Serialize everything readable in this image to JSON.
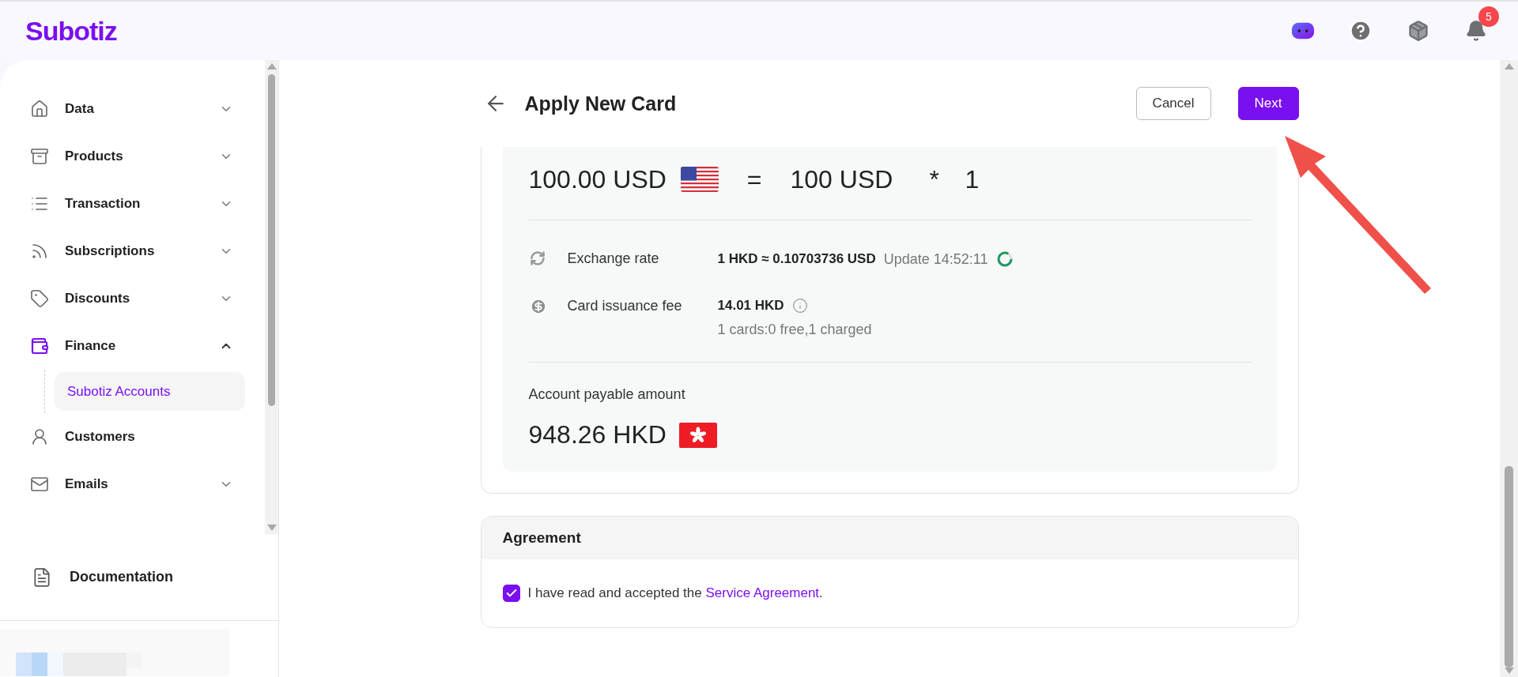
{
  "header": {
    "logo": "Subotiz",
    "notification_count": "5"
  },
  "sidebar": {
    "items": [
      {
        "label": "Data",
        "kind": "group",
        "expanded": false,
        "active": false
      },
      {
        "label": "Products",
        "kind": "group",
        "expanded": false,
        "active": false
      },
      {
        "label": "Transaction",
        "kind": "group",
        "expanded": false,
        "active": false
      },
      {
        "label": "Subscriptions",
        "kind": "group",
        "expanded": false,
        "active": false
      },
      {
        "label": "Discounts",
        "kind": "group",
        "expanded": false,
        "active": false
      },
      {
        "label": "Finance",
        "kind": "group",
        "expanded": true,
        "active": true,
        "children": [
          {
            "label": "Subotiz Accounts",
            "selected": true
          }
        ]
      },
      {
        "label": "Customers",
        "kind": "link",
        "active": false
      },
      {
        "label": "Emails",
        "kind": "group",
        "expanded": false,
        "active": false
      }
    ],
    "footer": {
      "label": "Documentation"
    }
  },
  "page": {
    "title": "Apply New Card",
    "buttons": [
      {
        "label": "Cancel",
        "kind": "secondary"
      },
      {
        "label": "Next",
        "kind": "primary"
      }
    ]
  },
  "summary": {
    "total": "100.00 USD",
    "equals": "=",
    "per_card": "100 USD",
    "times": "*",
    "count": "1"
  },
  "details": [
    {
      "kind": "rate",
      "label": "Exchange rate",
      "value": "1 HKD ≈ 0.10703736 USD",
      "note": "Update 14:52:11"
    },
    {
      "kind": "fee",
      "label": "Card issuance fee",
      "value": "14.01 HKD",
      "note": "1 cards:0 free,1 charged"
    }
  ],
  "payable": {
    "label": "Account payable amount",
    "amount": "948.26 HKD"
  },
  "agreement": {
    "title": "Agreement",
    "checked": true,
    "text": "I have read and accepted the ",
    "link": "Service Agreement",
    "tail": "."
  }
}
